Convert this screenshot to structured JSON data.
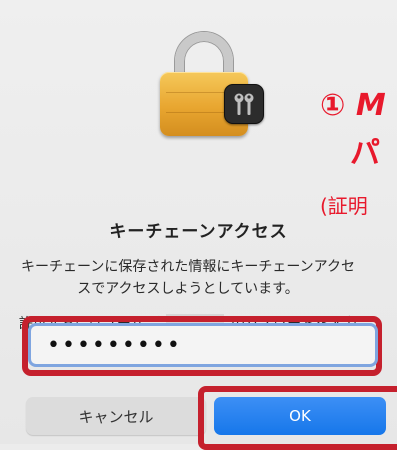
{
  "dialog": {
    "title": "キーチェーンアクセス",
    "message": "キーチェーンに保存された情報にキーチェーンアクセスでアクセスしようとしています。",
    "prompt_prefix": "許可するにはユーザ“",
    "username_partial": "高",
    "prompt_suffix": "”のパスワードを入力してください。",
    "password_value": "•••••••••",
    "cancel_label": "キャンセル",
    "ok_label": "OK"
  },
  "annotations": {
    "step1_line1": "① M",
    "step1_line2": "パ",
    "step1_line3": "(証明"
  },
  "colors": {
    "highlight": "#c5202d",
    "annotation_text": "#e8192c",
    "ok_button": "#1677ea"
  },
  "icons": {
    "app_icon": "keychain-access-padlock-icon"
  }
}
